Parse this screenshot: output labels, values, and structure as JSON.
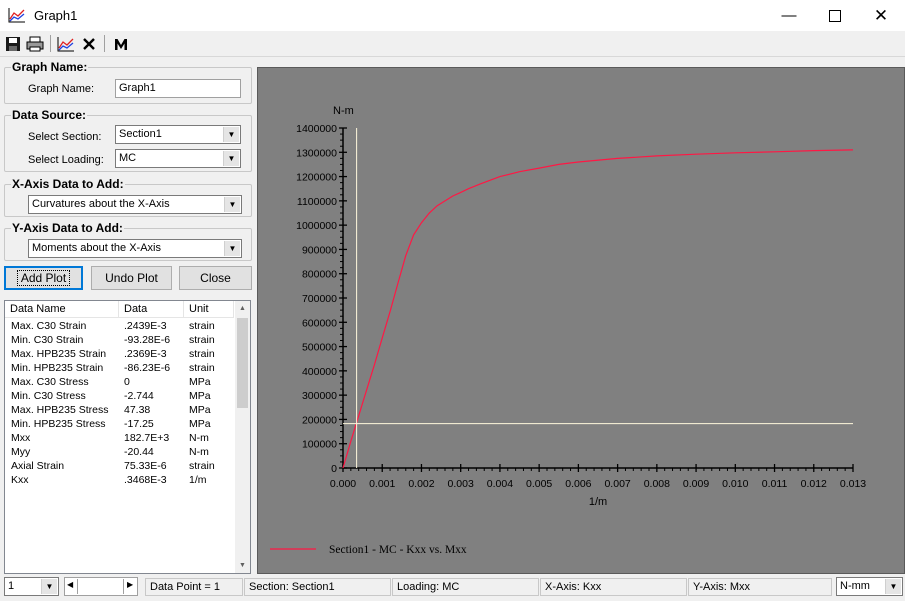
{
  "window": {
    "title": "Graph1"
  },
  "graph_name": {
    "group": "Graph Name:",
    "label": "Graph Name:",
    "value": "Graph1"
  },
  "data_source": {
    "group": "Data Source:",
    "section_label": "Select Section:",
    "section_value": "Section1",
    "loading_label": "Select Loading:",
    "loading_value": "MC"
  },
  "x_axis": {
    "group": "X-Axis Data to Add:",
    "value": "Curvatures about the X-Axis"
  },
  "y_axis": {
    "group": "Y-Axis Data to Add:",
    "value": "Moments about the X-Axis"
  },
  "buttons": {
    "add_plot": "Add Plot",
    "undo_plot": "Undo Plot",
    "close": "Close"
  },
  "table": {
    "headers": [
      "Data Name",
      "Data",
      "Unit"
    ],
    "rows": [
      {
        "name": "Max. C30 Strain",
        "data": ".2439E-3",
        "unit": "strain"
      },
      {
        "name": "Min. C30 Strain",
        "data": "-93.28E-6",
        "unit": "strain"
      },
      {
        "name": "Max. HPB235 Strain",
        "data": ".2369E-3",
        "unit": "strain"
      },
      {
        "name": "Min. HPB235 Strain",
        "data": "-86.23E-6",
        "unit": "strain"
      },
      {
        "name": "Max. C30 Stress",
        "data": "0",
        "unit": "MPa"
      },
      {
        "name": "Min. C30 Stress",
        "data": "-2.744",
        "unit": "MPa"
      },
      {
        "name": "Max. HPB235 Stress",
        "data": "47.38",
        "unit": "MPa"
      },
      {
        "name": "Min. HPB235 Stress",
        "data": "-17.25",
        "unit": "MPa"
      },
      {
        "name": "Mxx",
        "data": "182.7E+3",
        "unit": "N-m"
      },
      {
        "name": "Myy",
        "data": "-20.44",
        "unit": "N-m"
      },
      {
        "name": "Axial Strain",
        "data": "75.33E-6",
        "unit": "strain"
      },
      {
        "name": "Kxx",
        "data": ".3468E-3",
        "unit": "1/m"
      }
    ]
  },
  "status": {
    "page_select": "1",
    "data_point": "Data Point = 1",
    "section": "Section: Section1",
    "loading": "Loading: MC",
    "x_axis": "X-Axis: Kxx",
    "y_axis": "Y-Axis: Mxx",
    "units": "N-mm"
  },
  "colors": {
    "plot_bg": "#808080",
    "series": "#ff1744",
    "cursor": "#fff8dc"
  },
  "chart_data": {
    "type": "line",
    "xlabel": "1/m",
    "ylabel": "N-m",
    "xlim": [
      0,
      0.013
    ],
    "ylim": [
      0,
      1400000
    ],
    "x_ticks": [
      "0.000",
      "0.001",
      "0.002",
      "0.003",
      "0.004",
      "0.005",
      "0.006",
      "0.007",
      "0.008",
      "0.009",
      "0.010",
      "0.011",
      "0.012",
      "0.013"
    ],
    "y_ticks": [
      "0",
      "100000",
      "200000",
      "300000",
      "400000",
      "500000",
      "600000",
      "700000",
      "800000",
      "900000",
      "1000000",
      "1100000",
      "1200000",
      "1300000",
      "1400000"
    ],
    "series": [
      {
        "name": "Section1 - MC - Kxx vs. Mxx",
        "x": [
          0,
          0.0002,
          0.0004,
          0.0006,
          0.0008,
          0.001,
          0.0012,
          0.0014,
          0.0016,
          0.0018,
          0.002,
          0.0022,
          0.0024,
          0.0026,
          0.0028,
          0.003,
          0.0032,
          0.0035,
          0.004,
          0.0045,
          0.005,
          0.0055,
          0.006,
          0.007,
          0.008,
          0.009,
          0.01,
          0.011,
          0.012,
          0.013
        ],
        "y": [
          0,
          110000,
          215000,
          320000,
          425000,
          535000,
          645000,
          760000,
          875000,
          960000,
          1010000,
          1050000,
          1080000,
          1100000,
          1120000,
          1135000,
          1150000,
          1170000,
          1200000,
          1220000,
          1235000,
          1250000,
          1260000,
          1275000,
          1285000,
          1292000,
          1298000,
          1302000,
          1307000,
          1310000
        ]
      }
    ],
    "cursor": {
      "x": 0.000347,
      "y": 182700
    }
  }
}
